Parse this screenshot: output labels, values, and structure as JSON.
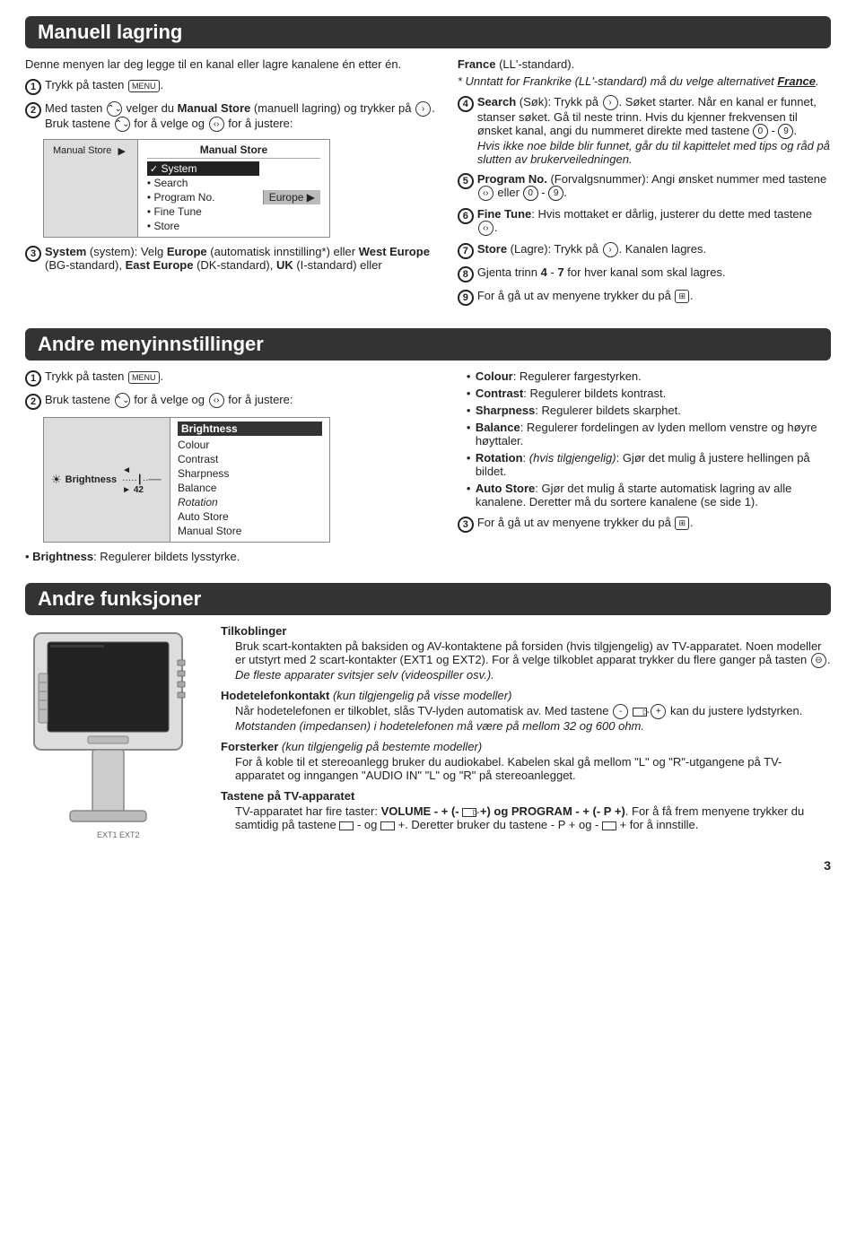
{
  "sections": {
    "manuell": {
      "title": "Manuell lagring",
      "intro": "Denne menyen lar deg legge til en kanal eller lagre kanalene én etter én.",
      "steps": [
        {
          "num": "1",
          "text": "Trykk på tasten [MENU]."
        },
        {
          "num": "2",
          "text": "Med tasten [up/down] velger du Manual Store (manuell lagring) og trykker på [right]. Bruk tastene [up/down] for å velge og [left/right] for å justere:"
        },
        {
          "num": "3",
          "text": "System (system): Velg Europe (automatisk innstilling*) eller West Europe (BG-standard), East Europe (DK-standard), UK (I-standard) eller"
        }
      ],
      "menu": {
        "left_label": "Manual Store",
        "right_header": "Manual Store",
        "selected": "System",
        "europe_label": "Europe",
        "items": [
          "System",
          "Search",
          "Program No.",
          "Fine Tune",
          "Store"
        ]
      },
      "right_col": {
        "france_text": "France (LL'-standard).",
        "france_note": "* Unntatt for Frankrike (LL'-standard) må du velge alternativet France.",
        "steps": [
          {
            "num": "4",
            "text": "Search (Søk): Trykk på [right]. Søket starter. Når en kanal er funnet, stanser søket. Gå til neste trinn. Hvis du kjenner frekvensen til ønsket kanal, angi du nummeret direkte med tastene (0) - (9). Hvis ikke noe bilde blir funnet, går du til kapittelet med tips og råd på slutten av brukerveiledningen."
          },
          {
            "num": "5",
            "text": "Program No. (Forvalgsnummer): Angi ønsket nummer med tastene [left/right] eller (0) - (9)."
          },
          {
            "num": "6",
            "text": "Fine Tune: Hvis mottaket er dårlig, justerer du dette med tastene [left/right]."
          },
          {
            "num": "7",
            "text": "Store (Lagre): Trykk på [right]. Kanalen lagres."
          },
          {
            "num": "8",
            "text": "Gjenta trinn 4 - 7 for hver kanal som skal lagres."
          },
          {
            "num": "9",
            "text": "For å gå ut av menyene trykker du på [menu-icon]."
          }
        ]
      }
    },
    "andre_meny": {
      "title": "Andre menyinnstillinger",
      "steps": [
        {
          "num": "1",
          "text": "Trykk på tasten [MENU]."
        },
        {
          "num": "2",
          "text": "Bruk tastene [up/down] for å velge og [left/right] for å justere:"
        }
      ],
      "menu": {
        "left_label": "Brightness",
        "selected": "Brightness",
        "value": "42",
        "items": [
          "Brightness",
          "Colour",
          "Contrast",
          "Sharpness",
          "Balance",
          "Rotation",
          "Auto Store",
          "Manual Store"
        ]
      },
      "brightness_note": "Brightness: Regulerer bildets lysstyrke.",
      "right_col": {
        "items": [
          "Colour: Regulerer fargestyrken.",
          "Contrast: Regulerer bildets kontrast.",
          "Sharpness: Regulerer bildets skarphet.",
          "Balance: Regulerer fordelingen av lyden mellom venstre og høyre høyttaler.",
          "Rotation: (hvis tilgjengelig): Gjør det mulig å justere hellingen på bildet.",
          "Auto Store: Gjør det mulig å starte automatisk lagring av alle kanalene. Deretter må du sortere kanalene (se side 1)."
        ],
        "step3": "For å gå ut av menyene trykker du på [menu-icon]."
      }
    },
    "andre_funk": {
      "title": "Andre funksjoner",
      "sections": [
        {
          "title": "Tilkoblinger",
          "body": "Bruk scart-kontakten på baksiden og AV-kontaktene på forsiden (hvis tilgjengelig) av TV-apparatet. Noen modeller er utstyrt med 2 scart-kontakter (EXT1 og EXT2). For å velge tilkoblet apparat trykker du flere ganger på tasten [ext].",
          "note": "De fleste apparater svitsjer selv (videospiller osv.)."
        },
        {
          "title": "Hodetelefonkontakt",
          "title_italic": "(kun tilgjengelig på visse modeller)",
          "body": "Når hodetelefonen er tilkoblet, slås TV-lyden automatisk av. Med tastene [-] [vol-] [+] kan du justere lydstyrken.",
          "note": "Motstanden (impedansen) i hodetelefonen må være på mellom 32 og 600 ohm."
        },
        {
          "title": "Forsterker",
          "title_italic": "(kun tilgjengelig på bestemte modeller)",
          "body": "For å koble til et stereoanlegg bruker du audiokabel. Kabelen skal gå mellom \"L\" og \"R\"-utgangene på TV-apparatet og inngangen \"AUDIO IN\" \"L\" og \"R\" på stereoanlegget."
        },
        {
          "title": "Tastene på TV-apparatet",
          "body": "TV-apparatet har fire taster: VOLUME - + (- [vol] +) og PROGRAM - + (- P +). For å få frem menyene trykker du samtidig på tastene [vol] - og [vol] +. Deretter bruker du tastene - P + og - [vol] + for å innstille."
        }
      ]
    }
  },
  "page_number": "3"
}
